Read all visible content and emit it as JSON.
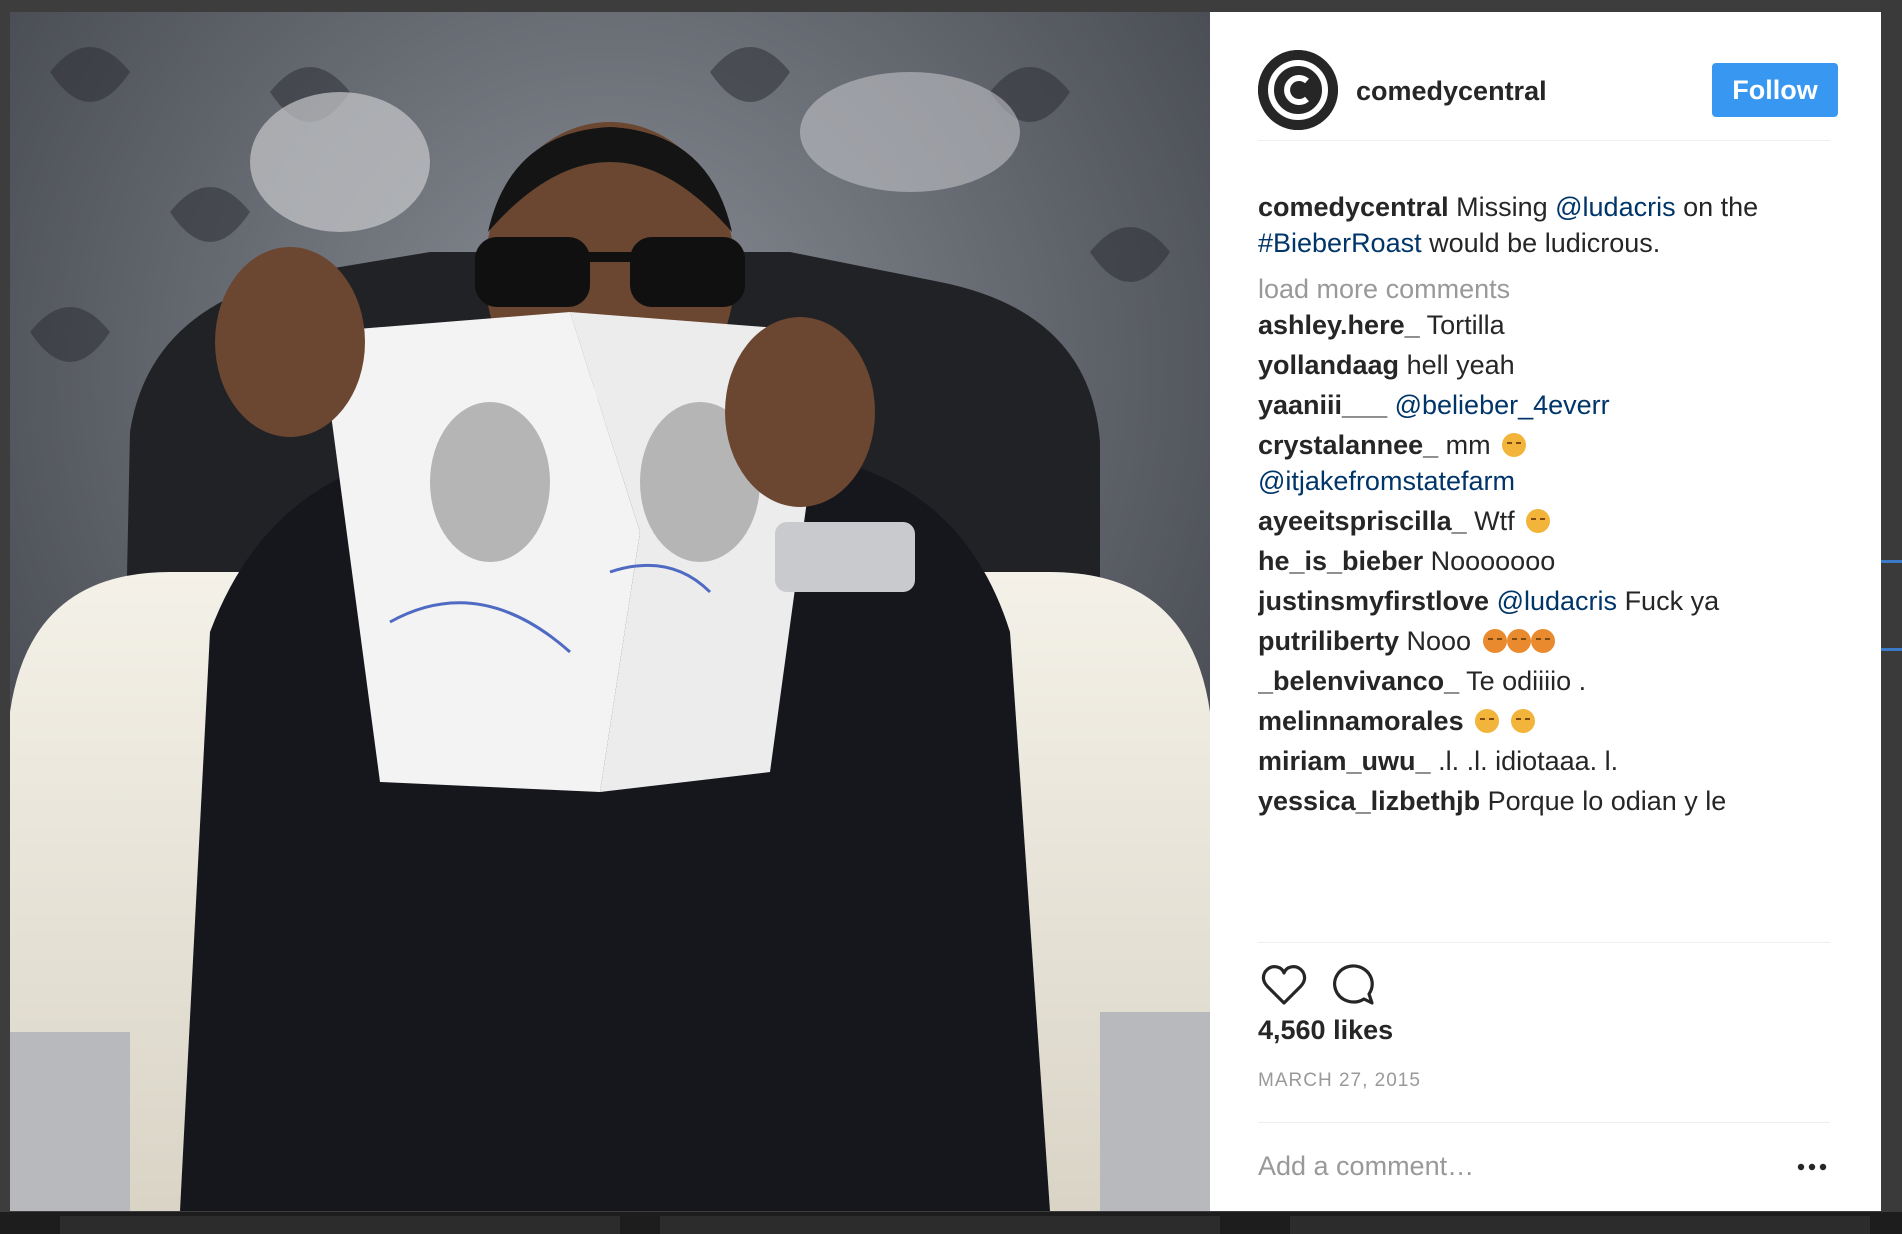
{
  "post": {
    "username": "comedycentral",
    "follow_label": "Follow",
    "caption": {
      "user": "comedycentral",
      "text_1": " Missing ",
      "mention": "@ludacris",
      "text_2": " on the ",
      "hashtag": "#BieberRoast",
      "text_3": " would be ludicrous."
    },
    "load_more_label": "load more comments",
    "comments": [
      {
        "user": "ashley.here_",
        "text": "Tortilla"
      },
      {
        "user": "yollandaag",
        "text": "hell yeah"
      },
      {
        "user": "yaaniii___",
        "mention": "@belieber_4everr"
      },
      {
        "user": "crystalannee_",
        "text": "mm",
        "emoji": "unamused-emoji",
        "mention": "@itjakefromstatefarm"
      },
      {
        "user": "ayeeitspriscilla_",
        "text": "Wtf",
        "emoji": "unamused-emoji"
      },
      {
        "user": "he_is_bieber",
        "text": "Nooooooo"
      },
      {
        "user": "justinsmyfirstlove",
        "mention": "@ludacris",
        "text": "Fuck ya"
      },
      {
        "user": "putriliberty",
        "text": "Nooo",
        "emoji": "angry-emoji x3"
      },
      {
        "user": "_belenvivanco_",
        "text": "Te odiiiio ."
      },
      {
        "user": "melinnamorales",
        "emoji": "expressionless-emoji x2"
      },
      {
        "user": "miriam_uwu_",
        "text": ".l. .l. idiotaaa. l."
      },
      {
        "user": "yessica_lizbethjb",
        "text": "Porque lo odian y le"
      }
    ],
    "likes": "4,560 likes",
    "date": "MARCH 27, 2015",
    "add_comment_placeholder": "Add a comment…",
    "icons": {
      "like": "heart-icon",
      "comment": "comment-bubble-icon",
      "more": "more-options-icon",
      "avatar": "comedy-central-logo"
    },
    "colors": {
      "follow_button": "#3897f0",
      "link": "#003569",
      "muted": "#999999",
      "text": "#262626"
    }
  }
}
